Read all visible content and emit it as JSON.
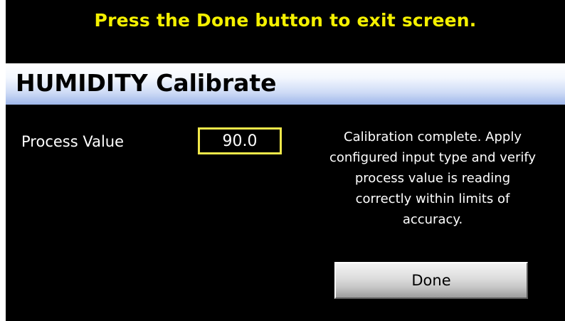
{
  "instruction": "Press the Done button to exit screen.",
  "title": "HUMIDITY Calibrate",
  "process_value": {
    "label": "Process Value",
    "value": "90.0"
  },
  "message": "Calibration complete. Apply\nconfigured input type and verify\nprocess value is reading\ncorrectly within limits of\naccuracy.",
  "buttons": {
    "done_label": "Done"
  },
  "colors": {
    "background": "#000000",
    "instruction_text": "#f4f000",
    "value_box_border": "#f1e84a",
    "title_bar_start": "#ffffff",
    "title_bar_end": "#9fb7ea"
  }
}
